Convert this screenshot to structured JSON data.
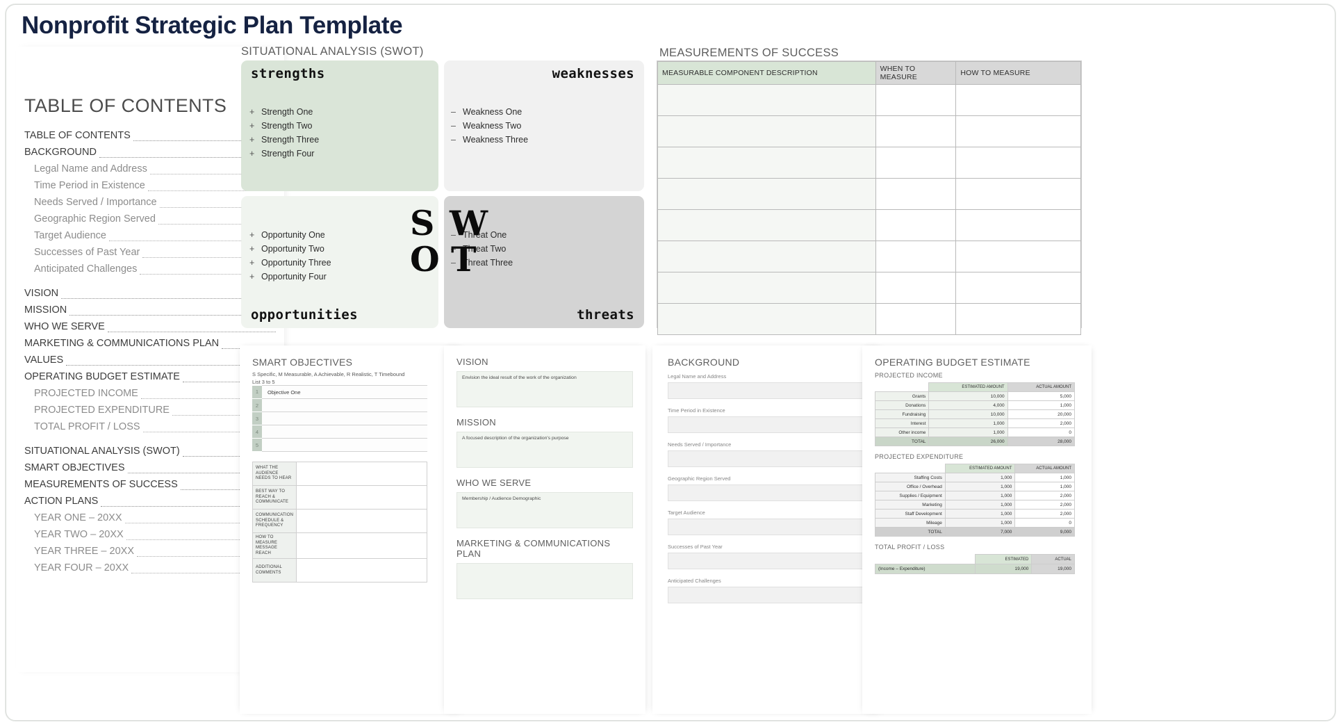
{
  "document": {
    "title": "Nonprofit Strategic Plan Template",
    "title_color": "#152242"
  },
  "toc": {
    "heading": "TABLE OF CONTENTS",
    "entries": [
      {
        "label": "TABLE OF CONTENTS",
        "level": 1,
        "gap": false
      },
      {
        "label": "BACKGROUND",
        "level": 1,
        "gap": false
      },
      {
        "label": "Legal Name and Address",
        "level": 2,
        "gap": false
      },
      {
        "label": "Time Period in Existence",
        "level": 2,
        "gap": false
      },
      {
        "label": "Needs Served / Importance",
        "level": 2,
        "gap": false
      },
      {
        "label": "Geographic Region Served",
        "level": 2,
        "gap": false
      },
      {
        "label": "Target Audience",
        "level": 2,
        "gap": false
      },
      {
        "label": "Successes of Past Year",
        "level": 2,
        "gap": false
      },
      {
        "label": "Anticipated Challenges",
        "level": 2,
        "gap": false
      },
      {
        "label": "VISION",
        "level": 1,
        "gap": true
      },
      {
        "label": "MISSION",
        "level": 1,
        "gap": false
      },
      {
        "label": "WHO WE SERVE",
        "level": 1,
        "gap": false
      },
      {
        "label": "MARKETING & COMMUNICATIONS PLAN",
        "level": 1,
        "gap": false
      },
      {
        "label": "VALUES",
        "level": 1,
        "gap": false
      },
      {
        "label": "OPERATING BUDGET ESTIMATE",
        "level": 1,
        "gap": false
      },
      {
        "label": "PROJECTED INCOME",
        "level": 2,
        "gap": false
      },
      {
        "label": "PROJECTED EXPENDITURE",
        "level": 2,
        "gap": false
      },
      {
        "label": "TOTAL PROFIT / LOSS",
        "level": 2,
        "gap": false
      },
      {
        "label": "SITUATIONAL ANALYSIS (SWOT)",
        "level": 1,
        "gap": true
      },
      {
        "label": "SMART OBJECTIVES",
        "level": 1,
        "gap": false
      },
      {
        "label": "MEASUREMENTS OF SUCCESS",
        "level": 1,
        "gap": false
      },
      {
        "label": "ACTION PLANS",
        "level": 1,
        "gap": false
      },
      {
        "label": "YEAR ONE  –  20XX",
        "level": 2,
        "gap": false
      },
      {
        "label": "YEAR TWO  –  20XX",
        "level": 2,
        "gap": false
      },
      {
        "label": "YEAR THREE  –  20XX",
        "level": 2,
        "gap": false
      },
      {
        "label": "YEAR FOUR  –  20XX",
        "level": 2,
        "gap": false
      }
    ]
  },
  "swot": {
    "section_label": "SITUATIONAL ANALYSIS (SWOT)",
    "letters": {
      "s": "S",
      "w": "W",
      "o": "O",
      "t": "T"
    },
    "strengths": {
      "title": "strengths",
      "bullet": "+",
      "items": [
        "Strength One",
        "Strength Two",
        "Strength Three",
        "Strength Four"
      ],
      "bg": "#dae5d8"
    },
    "weaknesses": {
      "title": "weaknesses",
      "bullet": "–",
      "items": [
        "Weakness One",
        "Weakness Two",
        "Weakness Three"
      ],
      "bg": "#f1f1f1"
    },
    "opportunities": {
      "title": "opportunities",
      "bullet": "+",
      "items": [
        "Opportunity One",
        "Opportunity Two",
        "Opportunity Three",
        "Opportunity Four"
      ],
      "bg": "#f0f4ef"
    },
    "threats": {
      "title": "threats",
      "bullet": "–",
      "items": [
        "Threat One",
        "Threat Two",
        "Threat Three"
      ],
      "bg": "#d4d4d4"
    }
  },
  "measurements": {
    "section_label": "MEASUREMENTS OF SUCCESS",
    "columns": [
      "MEASURABLE COMPONENT DESCRIPTION",
      "WHEN TO MEASURE",
      "HOW TO MEASURE"
    ],
    "row_count": 8,
    "header_accent": "#d8e5d6"
  },
  "smart": {
    "section_label": "SMART OBJECTIVES",
    "legend": "S Specific, M Measurable, A Achievable, R Realistic, T Timebound",
    "hint": "List 3 to 5",
    "rows": [
      {
        "num": "1",
        "value": "Objective One"
      },
      {
        "num": "2",
        "value": ""
      },
      {
        "num": "3",
        "value": ""
      },
      {
        "num": "4",
        "value": ""
      },
      {
        "num": "5",
        "value": ""
      }
    ],
    "audience_rows": [
      {
        "key": "WHAT THE AUDIENCE NEEDS TO HEAR",
        "value": ""
      },
      {
        "key": "BEST WAY TO REACH & COMMUNICATE",
        "value": ""
      },
      {
        "key": "COMMUNICATION SCHEDULE & FREQUENCY",
        "value": ""
      },
      {
        "key": "HOW TO MEASURE MESSAGE REACH",
        "value": ""
      },
      {
        "key": "ADDITIONAL COMMENTS",
        "value": ""
      }
    ]
  },
  "vision_panel": {
    "blocks": [
      {
        "label": "VISION",
        "placeholder": "Envision the ideal result of the work of the organization"
      },
      {
        "label": "MISSION",
        "placeholder": "A focused description of the organization's purpose"
      },
      {
        "label": "WHO WE SERVE",
        "placeholder": "Membership / Audience Demographic"
      },
      {
        "label": "MARKETING & COMMUNICATIONS PLAN",
        "placeholder": ""
      }
    ]
  },
  "background_panel": {
    "section_label": "BACKGROUND",
    "fields": [
      "Legal Name and Address",
      "Time Period in Existence",
      "Needs Served / Importance",
      "Geographic Region Served",
      "Target Audience",
      "Successes of Past Year",
      "Anticipated Challenges"
    ]
  },
  "budget_panel": {
    "section_label": "OPERATING BUDGET ESTIMATE",
    "income": {
      "subtitle": "PROJECTED INCOME",
      "columns": [
        "",
        "ESTIMATED AMOUNT",
        "ACTUAL AMOUNT"
      ],
      "rows": [
        {
          "label": "Grants",
          "estimated": "10,000",
          "actual": "5,000"
        },
        {
          "label": "Donations",
          "estimated": "4,000",
          "actual": "1,000"
        },
        {
          "label": "Fundraising",
          "estimated": "10,000",
          "actual": "20,000"
        },
        {
          "label": "Interest",
          "estimated": "1,000",
          "actual": "2,000"
        },
        {
          "label": "Other income",
          "estimated": "1,000",
          "actual": "0"
        }
      ],
      "total": {
        "label": "TOTAL",
        "estimated": "26,000",
        "actual": "28,000"
      }
    },
    "expenditure": {
      "subtitle": "PROJECTED EXPENDITURE",
      "columns": [
        "",
        "ESTIMATED AMOUNT",
        "ACTUAL AMOUNT"
      ],
      "rows": [
        {
          "label": "Staffing Costs",
          "estimated": "1,000",
          "actual": "1,000"
        },
        {
          "label": "Office / Overhead",
          "estimated": "1,000",
          "actual": "1,000"
        },
        {
          "label": "Supplies / Equipment",
          "estimated": "1,000",
          "actual": "2,000"
        },
        {
          "label": "Marketing",
          "estimated": "1,000",
          "actual": "2,000"
        },
        {
          "label": "Staff Development",
          "estimated": "1,000",
          "actual": "2,000"
        },
        {
          "label": "Mileage",
          "estimated": "1,000",
          "actual": "0"
        }
      ],
      "total": {
        "label": "TOTAL",
        "estimated": "7,000",
        "actual": "9,000"
      }
    },
    "profit_loss": {
      "subtitle": "TOTAL PROFIT / LOSS",
      "columns": [
        "",
        "ESTIMATED",
        "ACTUAL"
      ],
      "row": {
        "label": "(Income – Expenditure)",
        "estimated": "19,000",
        "actual": "19,000"
      }
    }
  },
  "colors": {
    "accent_green": "#dae5d8",
    "accent_green_light": "#f0f4ef",
    "accent_gray": "#d4d4d4",
    "title_navy": "#152242"
  }
}
